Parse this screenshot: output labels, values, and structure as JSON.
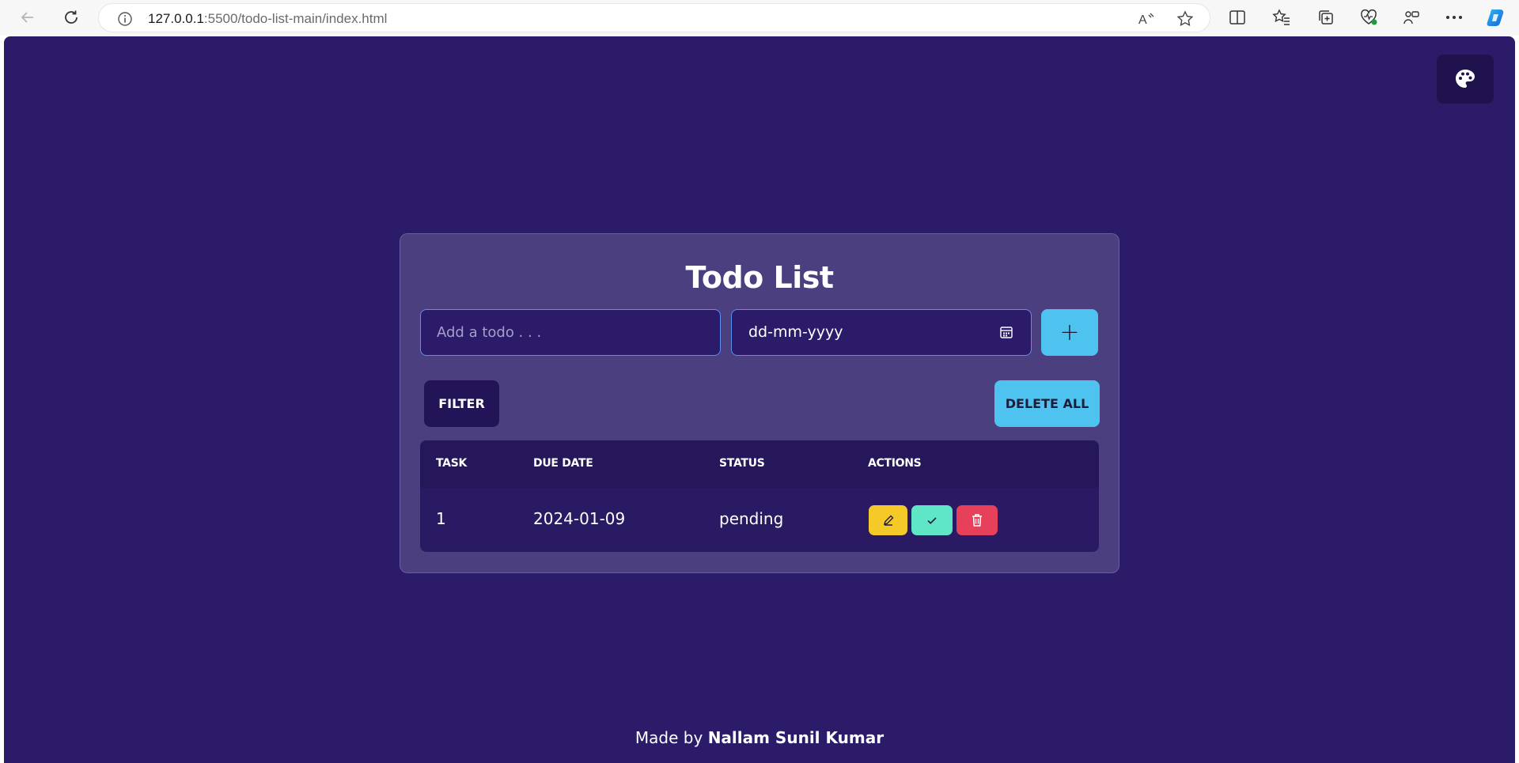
{
  "browser": {
    "url_host": "127.0.0.1",
    "url_path": ":5500/todo-list-main/index.html"
  },
  "app": {
    "title": "Todo List",
    "todo_input": {
      "placeholder": "Add a todo . . ."
    },
    "date_input": {
      "placeholder": "dd-mm-yyyy"
    },
    "add_label": "+",
    "filter_label": "FILTER",
    "delete_all_label": "DELETE ALL",
    "table": {
      "headers": [
        "TASK",
        "DUE DATE",
        "STATUS",
        "ACTIONS"
      ],
      "rows": [
        {
          "task": "1",
          "due_date": "2024-01-09",
          "status": "pending"
        }
      ]
    },
    "footer": {
      "prefix": "Made by",
      "author": "Nallam Sunil Kumar"
    }
  },
  "colors": {
    "page_bg": "#2c1b69",
    "accent": "#4ec3f0",
    "edit": "#f5c928",
    "complete": "#5ee6c6",
    "delete": "#e6405a"
  },
  "icons": {
    "theme": "palette-icon",
    "edit": "pencil-icon",
    "complete": "check-icon",
    "delete": "trash-icon"
  }
}
